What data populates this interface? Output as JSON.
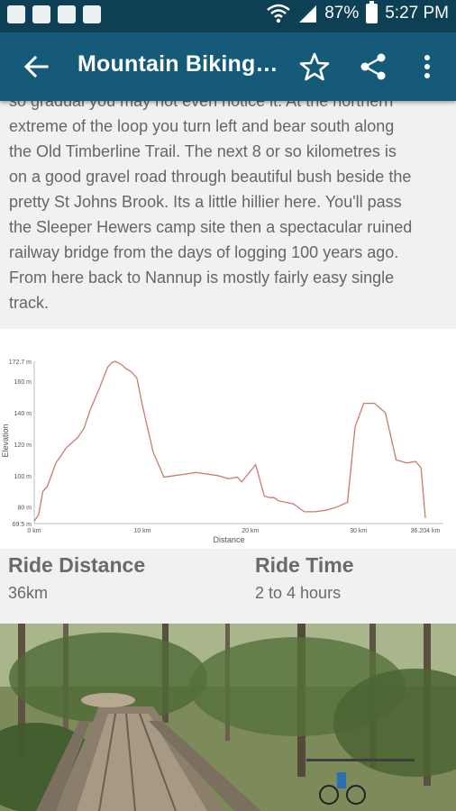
{
  "status": {
    "battery": "87%",
    "time": "5:27 PM"
  },
  "appbar": {
    "title": "Mountain Biking…"
  },
  "description": [
    "so gradual you may not even notice it. At the northern",
    "extreme of the loop you turn left and bear south along",
    "the Old Timberline Trail. The next 8 or so kilometres is",
    "on a good gravel road through beautiful bush beside the",
    "pretty St Johns Brook. Its a little hillier here. You'll pass",
    "the Sleeper Hewers camp site then a spectacular ruined",
    "railway bridge from the days of logging 100 years ago.",
    "From here back to Nannup is mostly fairly easy single",
    "track."
  ],
  "chart_data": {
    "type": "line",
    "xlabel": "Distance",
    "ylabel": "Elevation",
    "xlim": [
      0,
      36.204
    ],
    "ylim": [
      69.5,
      172.7
    ],
    "xtick_labels": [
      "0 km",
      "10 km",
      "20 km",
      "30 km",
      "36.204 km"
    ],
    "xtick_values": [
      0,
      10,
      20,
      30,
      36.204
    ],
    "ytick_labels": [
      "69.5 m",
      "80 m",
      "100 m",
      "120 m",
      "140 m",
      "160 m",
      "172.7 m"
    ],
    "ytick_values": [
      69.5,
      80,
      100,
      120,
      140,
      160,
      172.7
    ],
    "color": "#cc7a6e",
    "x": [
      0,
      0.4,
      0.8,
      1.2,
      2,
      3,
      4,
      4.6,
      5.2,
      6,
      6.8,
      7.2,
      7.5,
      8,
      8.5,
      9,
      9.5,
      10,
      10.5,
      11,
      12,
      13,
      14,
      15,
      16,
      17,
      18,
      18.8,
      19.2,
      20.5,
      21.3,
      21.8,
      22.2,
      22.6,
      24,
      25,
      26,
      27,
      28,
      29,
      29.7,
      30.5,
      31.5,
      32.5,
      33.5,
      34.5,
      35.3,
      35.8,
      36.204
    ],
    "y": [
      71,
      75,
      90,
      93,
      108,
      118,
      124,
      130,
      142,
      155,
      169,
      172,
      172.7,
      171,
      168,
      166,
      162,
      145,
      130,
      115,
      99,
      100,
      101,
      102,
      101,
      100,
      98,
      99,
      96,
      107,
      87,
      86,
      86,
      84,
      82,
      77,
      77,
      78,
      80,
      83,
      131,
      146,
      146,
      140,
      110,
      108,
      109,
      105,
      73
    ]
  },
  "stats": {
    "distance_label": "Ride Distance",
    "distance_value": "36km",
    "time_label": "Ride Time",
    "time_value": "2 to 4 hours"
  },
  "colors": {
    "statusbar": "#0d3f55",
    "appbar": "#155a78",
    "line": "#cc7a6e",
    "text": "#666666"
  }
}
